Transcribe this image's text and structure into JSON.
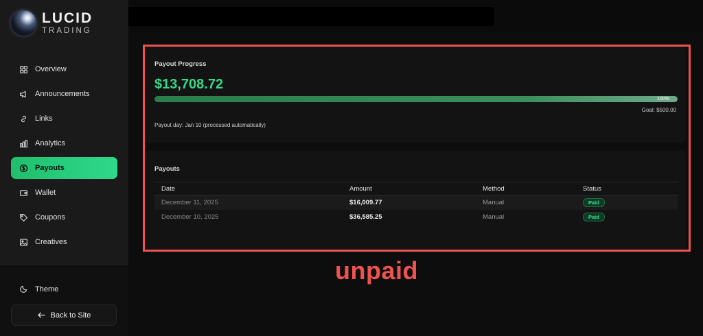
{
  "brand": {
    "line1": "LUCID",
    "line2": "TRADING"
  },
  "sidebar": {
    "items": [
      {
        "label": "Overview",
        "icon": "grid-icon"
      },
      {
        "label": "Announcements",
        "icon": "megaphone-icon"
      },
      {
        "label": "Links",
        "icon": "link-icon"
      },
      {
        "label": "Analytics",
        "icon": "bar-chart-icon"
      },
      {
        "label": "Payouts",
        "icon": "dollar-circle-icon",
        "active": true
      },
      {
        "label": "Wallet",
        "icon": "wallet-icon"
      },
      {
        "label": "Coupons",
        "icon": "tag-icon"
      },
      {
        "label": "Creatives",
        "icon": "image-icon"
      }
    ],
    "theme_label": "Theme",
    "back_label": "Back to Site"
  },
  "progress": {
    "title": "Payout Progress",
    "amount": "$13,708.72",
    "percent_label": "100%",
    "percent": 100,
    "goal": "Goal: $500.00",
    "payout_day": "Payout day: Jan 10 (processed automatically)"
  },
  "payouts": {
    "title": "Payouts",
    "columns": [
      "Date",
      "Amount",
      "Method",
      "Status"
    ],
    "rows": [
      {
        "date": "December 11, 2025",
        "amount": "$16,009.77",
        "method": "Manual",
        "status": "Paid"
      },
      {
        "date": "December 10, 2025",
        "amount": "$36,585.25",
        "method": "Manual",
        "status": "Paid"
      }
    ]
  },
  "annotation": {
    "text": "unpaid"
  },
  "colors": {
    "accent": "#2fd98a",
    "annotation": "#ee5350",
    "sidebar_bg": "#1a1a1a",
    "main_bg": "#0d0d0d"
  }
}
